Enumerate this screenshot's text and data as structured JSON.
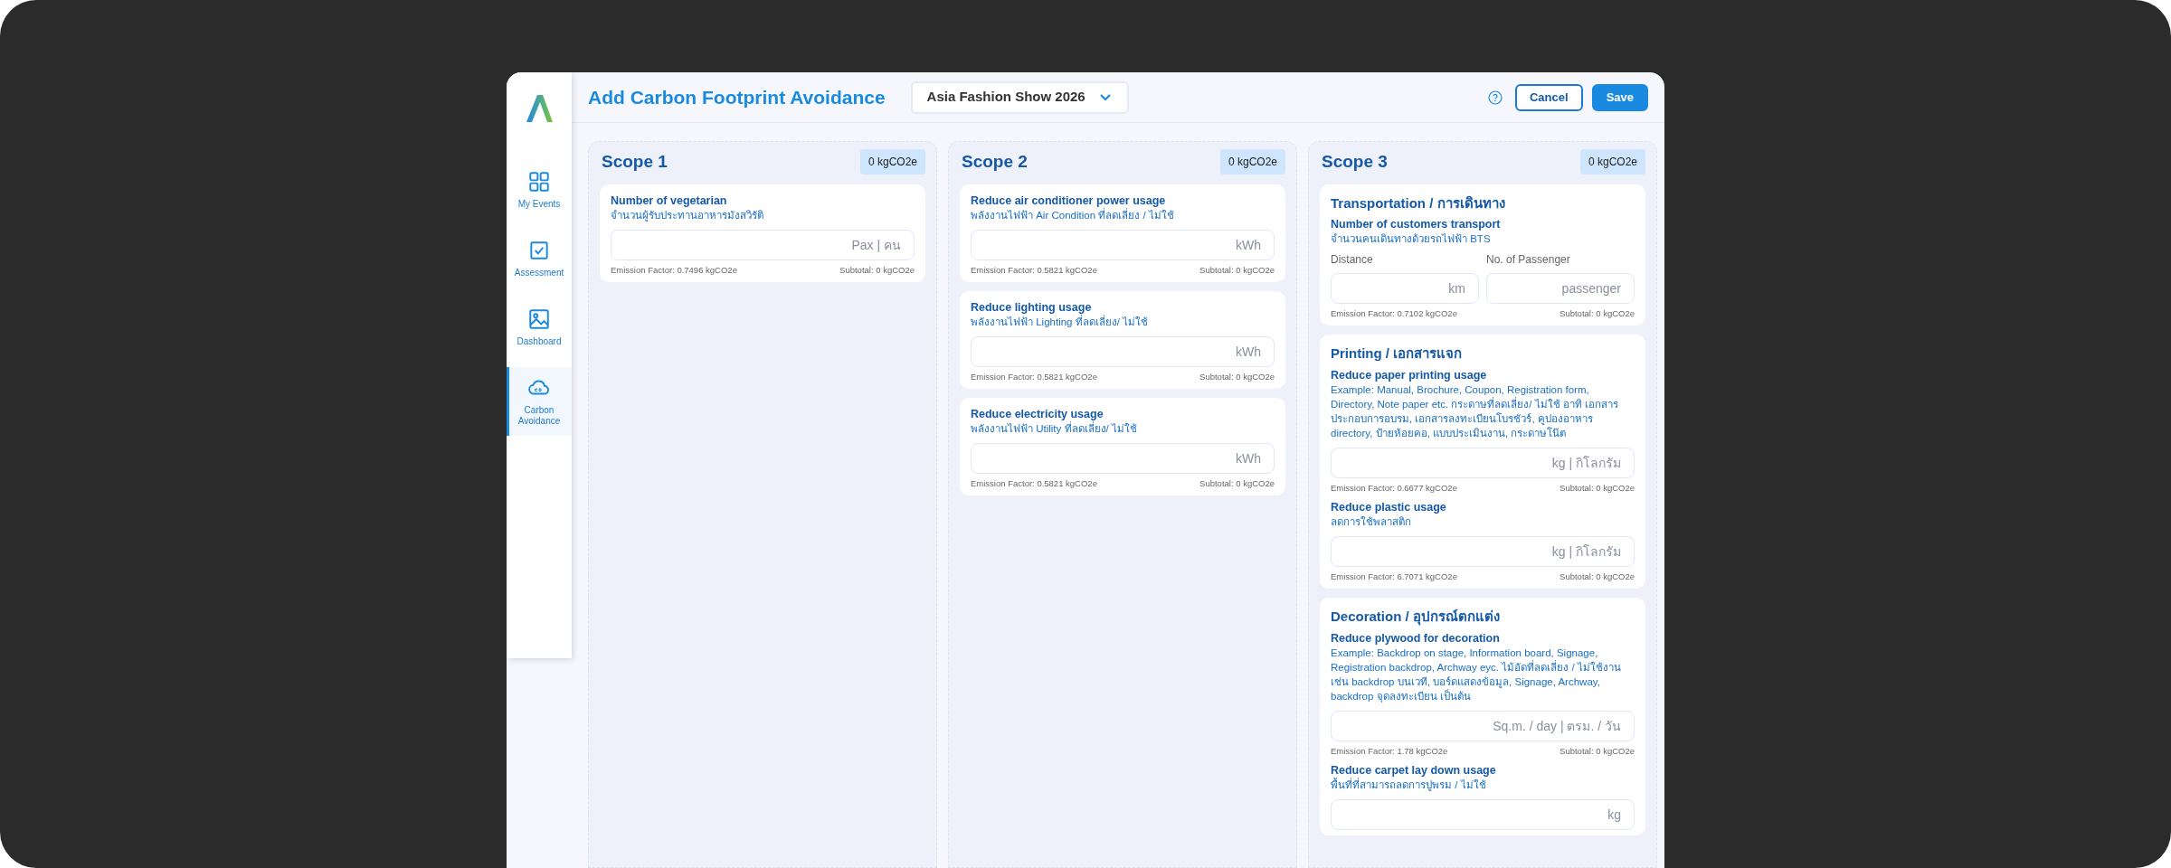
{
  "sidebar": {
    "items": [
      {
        "label": "My Events",
        "selected": false
      },
      {
        "label": "Assessment",
        "selected": false
      },
      {
        "label": "Dashboard",
        "selected": false
      },
      {
        "label": "Carbon Avoidance",
        "selected": true
      }
    ]
  },
  "header": {
    "title": "Add Carbon Footprint Avoidance",
    "event_select": {
      "value": "Asia Fashion Show 2026"
    },
    "buttons": [
      {
        "label": "Cancel",
        "kind": "outline"
      },
      {
        "label": "Save",
        "kind": "primary"
      }
    ]
  },
  "scopes": [
    {
      "title": "Scope 1",
      "total": "0 kgCO2e",
      "groups": [
        {
          "items": [
            {
              "title": "Number of vegetarian",
              "desc": "จำนวนผู้รับประทานอาหารมังสวิรัติ",
              "inputs": [
                {
                  "placeholder": "Pax | คน"
                }
              ],
              "factor": "Emission Factor: 0.7496 kgCO2e",
              "subtotal": "Subtotal: 0 kgCO2e"
            }
          ]
        }
      ]
    },
    {
      "title": "Scope 2",
      "total": "0 kgCO2e",
      "groups": [
        {
          "items": [
            {
              "title": "Reduce air conditioner power usage",
              "desc": "พลังงานไฟฟ้า Air Condition ที่ลดเลี่ยง / ไม่ใช้",
              "inputs": [
                {
                  "placeholder": "kWh"
                }
              ],
              "factor": "Emission Factor: 0.5821 kgCO2e",
              "subtotal": "Subtotal: 0 kgCO2e"
            }
          ]
        },
        {
          "items": [
            {
              "title": "Reduce lighting usage",
              "desc": "พลังงานไฟฟ้า Lighting ที่ลดเลี่ยง/ ไม่ใช้",
              "inputs": [
                {
                  "placeholder": "kWh"
                }
              ],
              "factor": "Emission Factor: 0.5821 kgCO2e",
              "subtotal": "Subtotal: 0 kgCO2e"
            }
          ]
        },
        {
          "items": [
            {
              "title": "Reduce electricity usage",
              "desc": "พลังงานไฟฟ้า Utility ที่ลดเลี่ยง/ ไม่ใช้",
              "inputs": [
                {
                  "placeholder": "kWh"
                }
              ],
              "factor": "Emission Factor: 0.5821 kgCO2e",
              "subtotal": "Subtotal: 0 kgCO2e"
            }
          ]
        }
      ]
    },
    {
      "title": "Scope 3",
      "total": "0 kgCO2e",
      "groups": [
        {
          "heading": "Transportation / การเดินทาง",
          "items": [
            {
              "title": "Number of customers transport",
              "desc": "จำนวนคนเดินทางด้วยรถไฟฟ้า BTS",
              "inputs": [
                {
                  "label": "Distance",
                  "placeholder": "km"
                },
                {
                  "label": "No. of Passenger",
                  "placeholder": "passenger"
                }
              ],
              "factor": "Emission Factor: 0.7102 kgCO2e",
              "subtotal": "Subtotal: 0 kgCO2e"
            }
          ]
        },
        {
          "heading": "Printing / เอกสารแจก",
          "items": [
            {
              "title": "Reduce paper printing usage",
              "desc": "Example: Manual, Brochure, Coupon, Registration form, Directory, Note paper etc. กระดาษที่ลดเลี่ยง/ ไม่ใช้ อาทิ เอกสารประกอบการอบรม, เอกสารลงทะเบียนโบรชัวร์, คูปองอาหาร directory, ป้ายห้อยคอ, แบบประเมินงาน, กระดาษโน๊ต",
              "inputs": [
                {
                  "placeholder": "kg | กิโลกรัม"
                }
              ],
              "factor": "Emission Factor: 0.6677 kgCO2e",
              "subtotal": "Subtotal: 0 kgCO2e"
            },
            {
              "title": "Reduce plastic usage",
              "desc": "ลดการใช้พลาสติก",
              "inputs": [
                {
                  "placeholder": "kg | กิโลกรัม"
                }
              ],
              "factor": "Emission Factor: 6.7071 kgCO2e",
              "subtotal": "Subtotal: 0 kgCO2e"
            }
          ]
        },
        {
          "heading": "Decoration / อุปกรณ์ตกแต่ง",
          "items": [
            {
              "title": "Reduce plywood for decoration",
              "desc": "Example: Backdrop on stage, Information board, Signage, Registration backdrop, Archway eyc. ไม้อัดที่ลดเลี่ยง / ไม่ใช้งาน เช่น backdrop บนเวที, บอร์ดแสดงข้อมูล, Signage, Archway, backdrop จุดลงทะเบียน เป็นต้น",
              "inputs": [
                {
                  "placeholder": "Sq.m. / day | ตรม. / วัน"
                }
              ],
              "factor": "Emission Factor: 1.78 kgCO2e",
              "subtotal": "Subtotal: 0 kgCO2e"
            },
            {
              "title": "Reduce carpet lay down usage",
              "desc": "พื้นที่ที่สามารถลดการปูพรม / ไม่ใช้",
              "inputs": [
                {
                  "placeholder": "kg"
                }
              ]
            }
          ]
        }
      ]
    }
  ]
}
